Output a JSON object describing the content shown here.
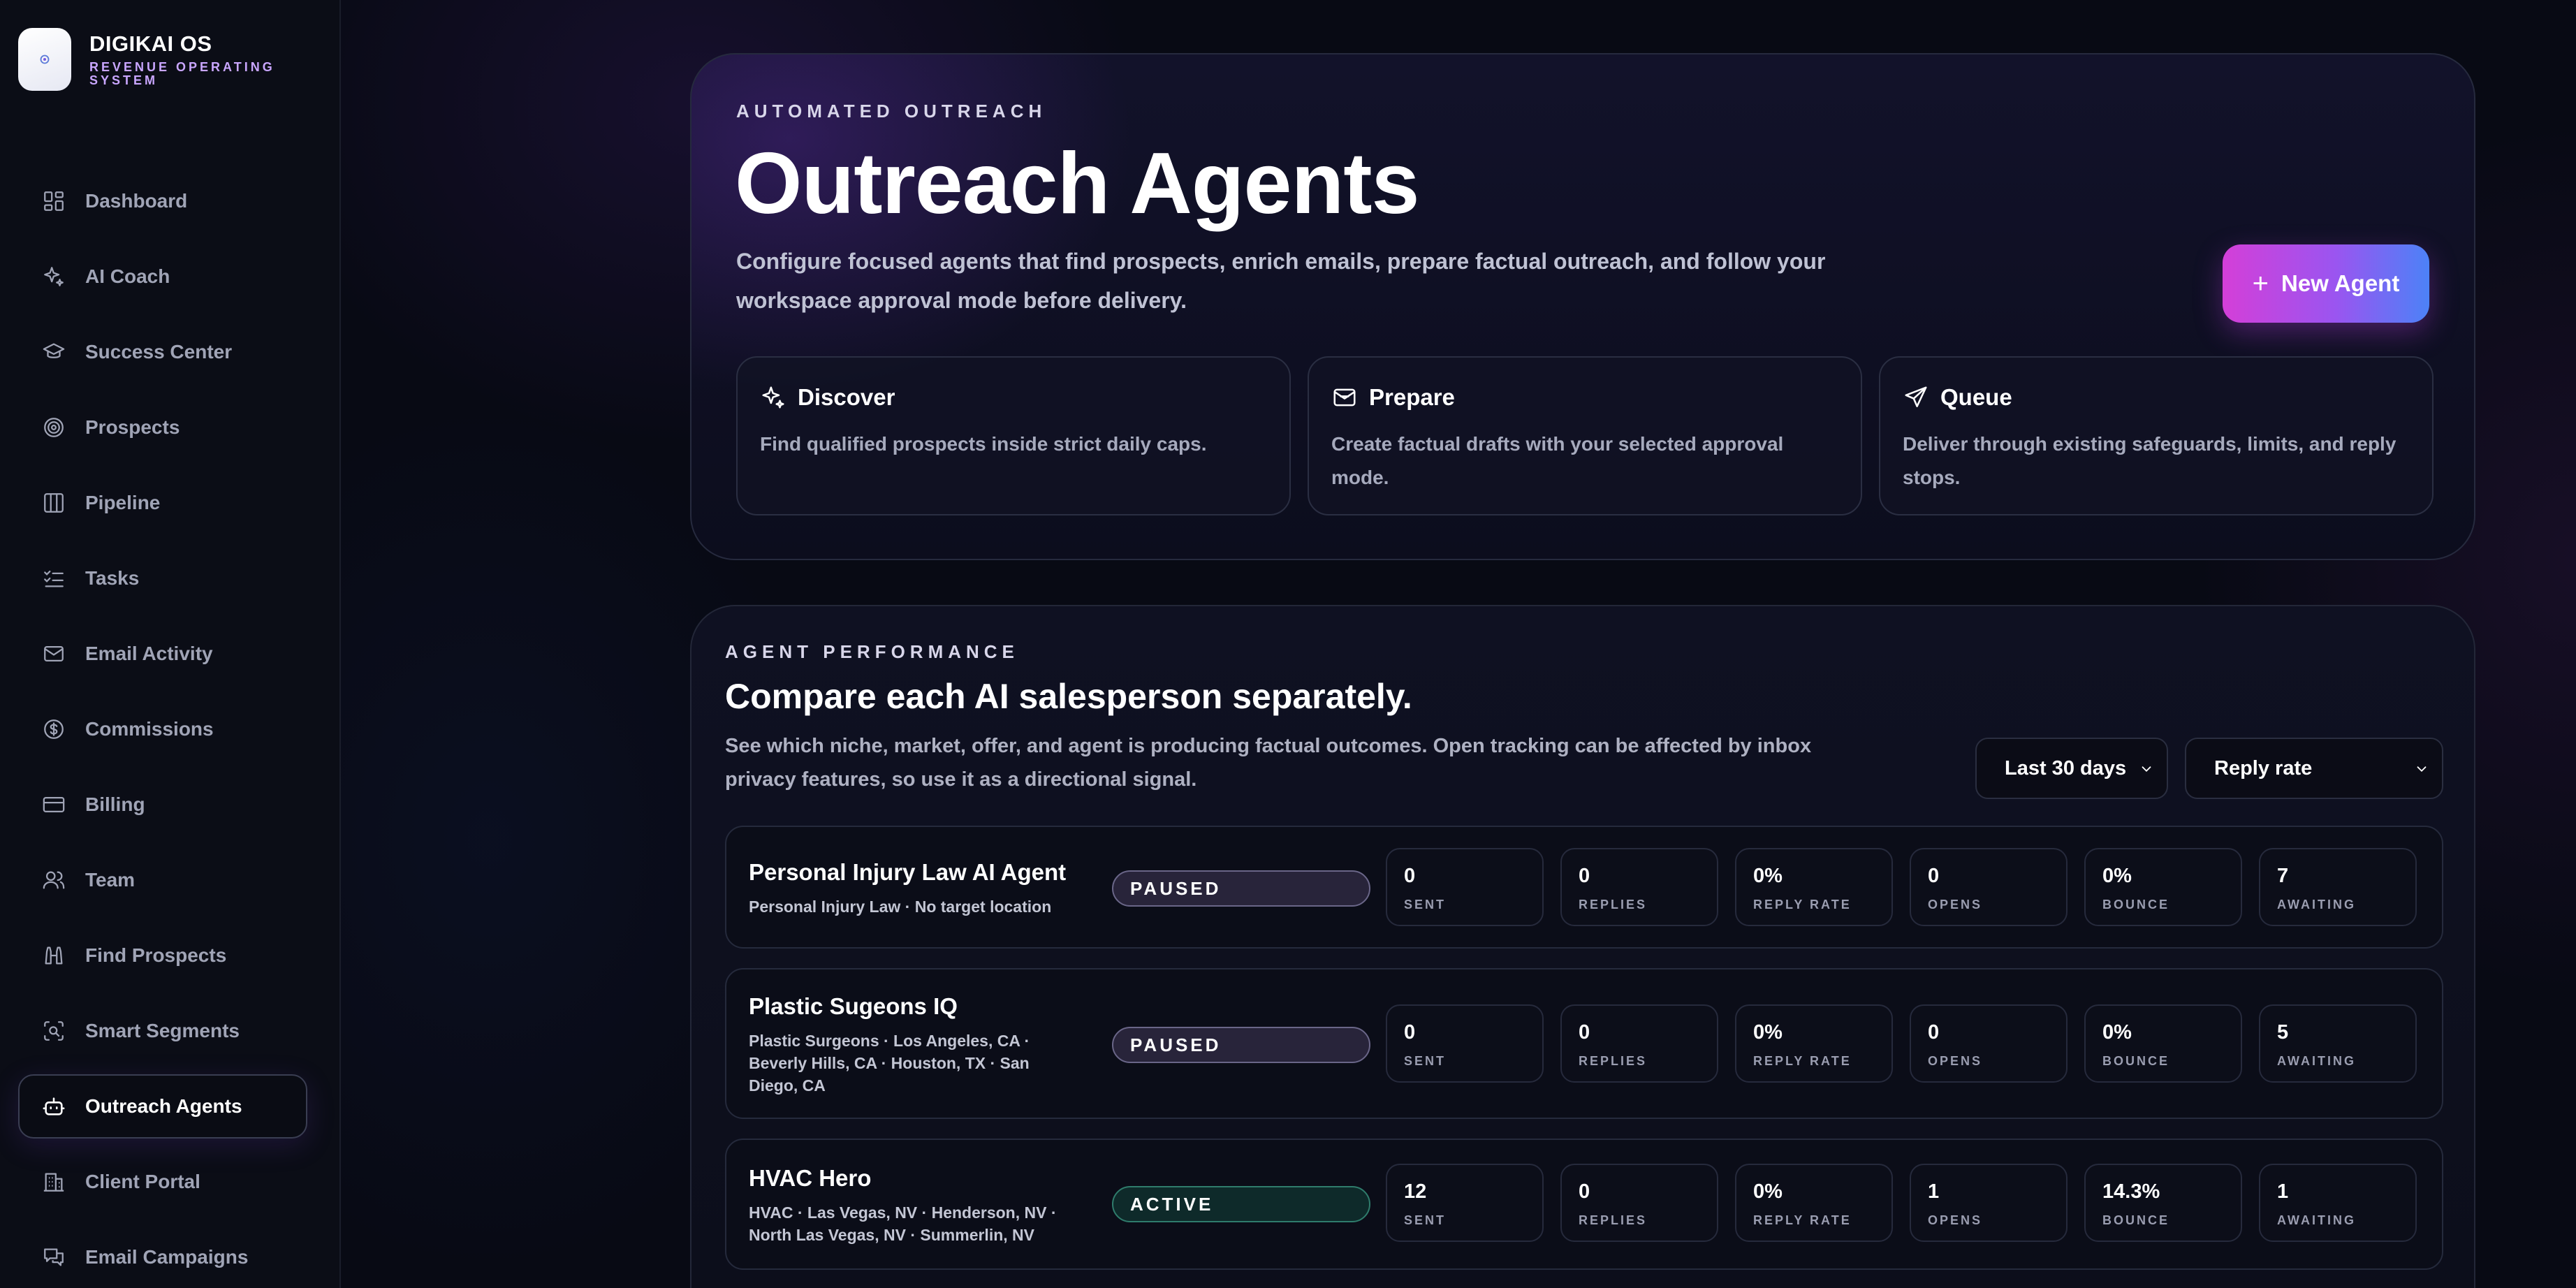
{
  "brand": {
    "name": "DIGIKAI OS",
    "subtitle": "REVENUE OPERATING SYSTEM"
  },
  "sidebar": {
    "items": [
      {
        "label": "Dashboard",
        "icon": "dashboard-icon"
      },
      {
        "label": "AI Coach",
        "icon": "sparkle-icon"
      },
      {
        "label": "Success Center",
        "icon": "graduation-cap-icon"
      },
      {
        "label": "Prospects",
        "icon": "target-icon"
      },
      {
        "label": "Pipeline",
        "icon": "columns-icon"
      },
      {
        "label": "Tasks",
        "icon": "checklist-icon"
      },
      {
        "label": "Email Activity",
        "icon": "mail-icon"
      },
      {
        "label": "Commissions",
        "icon": "dollar-icon"
      },
      {
        "label": "Billing",
        "icon": "credit-card-icon"
      },
      {
        "label": "Team",
        "icon": "users-icon"
      },
      {
        "label": "Find Prospects",
        "icon": "binoculars-icon"
      },
      {
        "label": "Smart Segments",
        "icon": "scan-search-icon"
      },
      {
        "label": "Outreach Agents",
        "icon": "bot-icon",
        "active": true
      },
      {
        "label": "Client Portal",
        "icon": "building-icon"
      },
      {
        "label": "Email Campaigns",
        "icon": "messages-icon"
      }
    ]
  },
  "hero": {
    "eyebrow": "AUTOMATED OUTREACH",
    "title": "Outreach Agents",
    "description": "Configure focused agents that find prospects, enrich emails, prepare factual outreach, and follow your workspace approval mode before delivery.",
    "new_agent_label": "New Agent",
    "steps": [
      {
        "title": "Discover",
        "icon": "sparkle-icon",
        "description": "Find qualified prospects inside strict daily caps."
      },
      {
        "title": "Prepare",
        "icon": "mail-open-icon",
        "description": "Create factual drafts with your selected approval mode."
      },
      {
        "title": "Queue",
        "icon": "send-icon",
        "description": "Deliver through existing safeguards, limits, and reply stops."
      }
    ]
  },
  "performance": {
    "eyebrow": "AGENT PERFORMANCE",
    "title": "Compare each AI salesperson separately.",
    "description": "See which niche, market, offer, and agent is producing factual outcomes. Open tracking can be affected by inbox privacy features, so use it as a directional signal.",
    "range_select": "Last 30 days",
    "metric_select": "Reply rate",
    "metric_labels": [
      "SENT",
      "REPLIES",
      "REPLY RATE",
      "OPENS",
      "BOUNCE",
      "AWAITING"
    ],
    "agents": [
      {
        "name": "Personal Injury Law AI Agent",
        "meta": "Personal Injury Law · No target location",
        "status": "PAUSED",
        "metrics": [
          "0",
          "0",
          "0%",
          "0",
          "0%",
          "7"
        ]
      },
      {
        "name": "Plastic Sugeons IQ",
        "meta": "Plastic Surgeons · Los Angeles, CA · Beverly Hills, CA · Houston, TX · San Diego, CA",
        "status": "PAUSED",
        "metrics": [
          "0",
          "0",
          "0%",
          "0",
          "0%",
          "5"
        ]
      },
      {
        "name": "HVAC Hero",
        "meta": "HVAC · Las Vegas, NV · Henderson, NV · North Las Vegas, NV · Summerlin, NV",
        "status": "ACTIVE",
        "metrics": [
          "12",
          "0",
          "0%",
          "1",
          "14.3%",
          "1"
        ]
      }
    ]
  }
}
